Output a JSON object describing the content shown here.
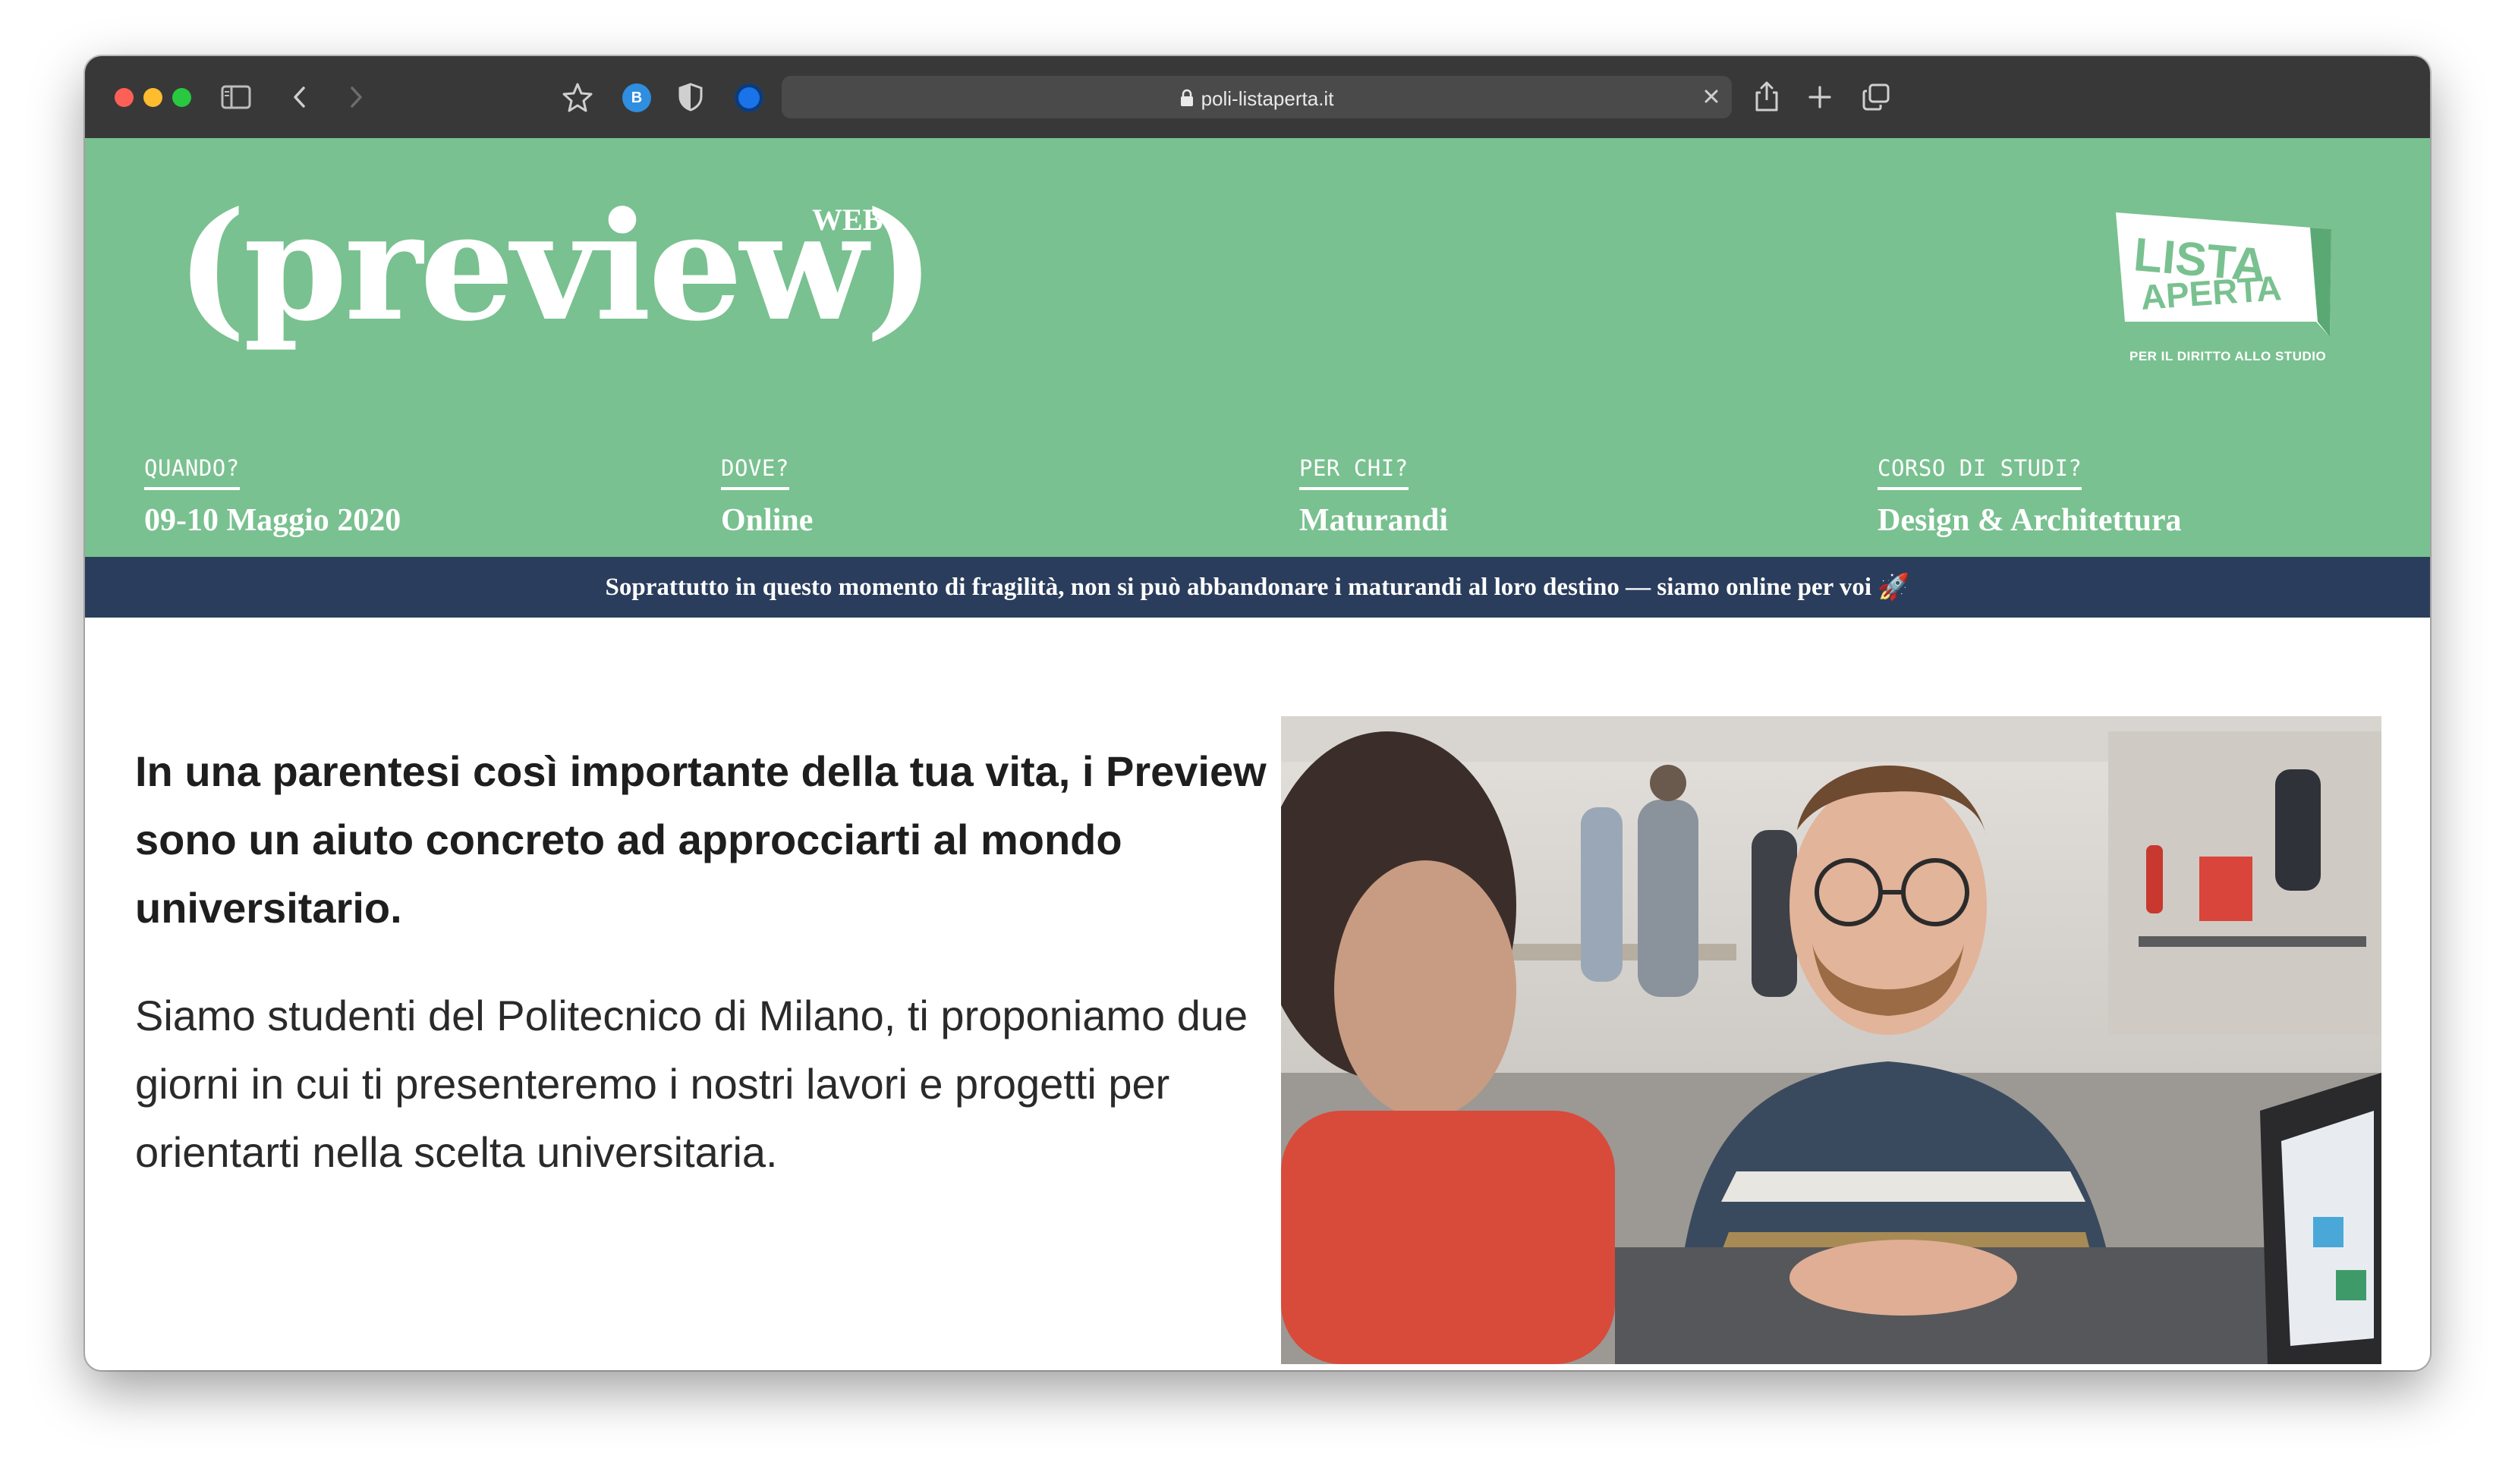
{
  "browser": {
    "url": "poli-listaperta.it",
    "extension_b_label": "B"
  },
  "hero": {
    "logo": "(preview)",
    "logo_tag": "WEB",
    "brand_line1": "LISTA",
    "brand_line2": "APERTA",
    "brand_tagline": "PER IL DIRITTO ALLO STUDIO",
    "info": [
      {
        "label": "QUANDO?",
        "value": "09-10 Maggio 2020"
      },
      {
        "label": "DOVE?",
        "value": "Online"
      },
      {
        "label": "PER CHI?",
        "value": "Maturandi"
      },
      {
        "label": "CORSO DI STUDI?",
        "value": "Design & Architettura"
      }
    ]
  },
  "banner": {
    "text": "Soprattutto in questo momento di fragilità, non si può abbandonare i maturandi al loro destino — siamo online per voi",
    "emoji": "🚀"
  },
  "content": {
    "intro_bold": "In una parentesi così importante della tua vita, i Preview sono un aiuto concreto ad approcciarti al mondo universitario.",
    "intro_body": "Siamo studenti del Politecnico di Milano, ti proponiamo due giorni in cui ti presenteremo i nostri lavori e progetti per orientarti nella scelta universitaria."
  },
  "colors": {
    "hero_green": "#79c190",
    "banner_navy": "#2a3d5c",
    "toolbar": "#383838"
  }
}
